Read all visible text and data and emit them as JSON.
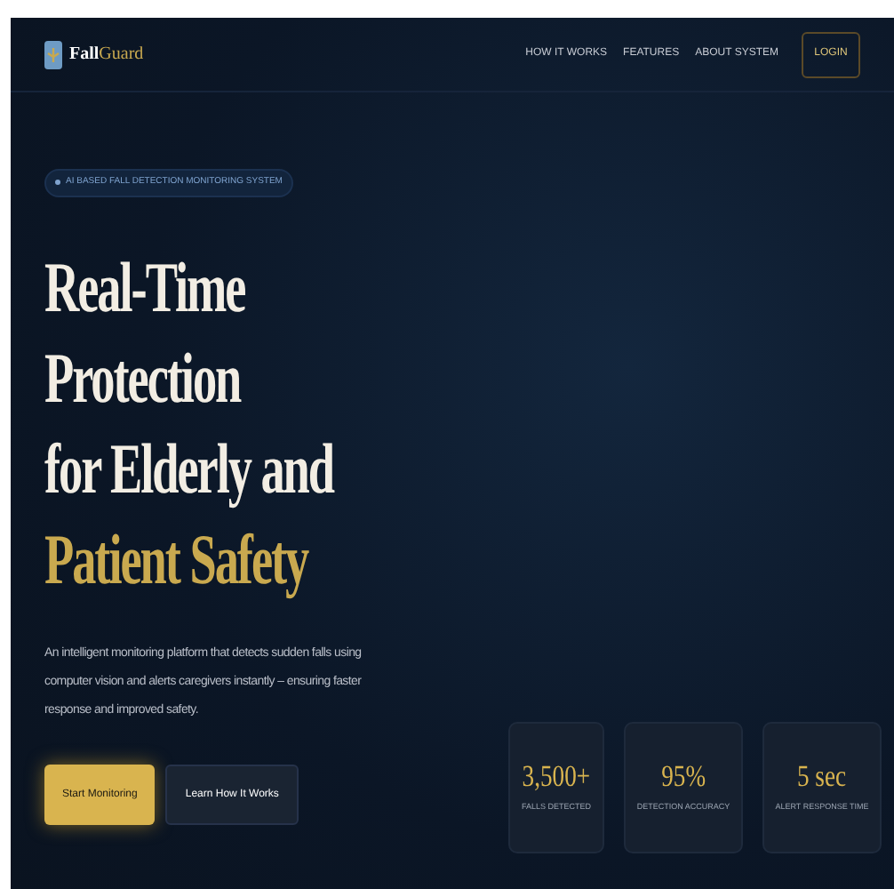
{
  "brand": {
    "name_first": "Fall",
    "name_second": "Guard"
  },
  "nav": {
    "links": [
      "HOW IT WORKS",
      "FEATURES",
      "ABOUT SYSTEM"
    ],
    "login": "LOGIN"
  },
  "badge": "AI BASED FALL DETECTION MONITORING SYSTEM",
  "headline": {
    "lines": [
      "Real-Time",
      "Protection",
      "for Elderly and"
    ],
    "accent": "Patient Safety"
  },
  "description": "An intelligent monitoring platform that detects sudden falls using computer vision and alerts caregivers instantly – ensuring faster response and improved safety.",
  "buttons": [
    {
      "label": "Start Monitoring",
      "kind": "primary"
    },
    {
      "label": "Learn How It Works",
      "kind": "secondary"
    }
  ],
  "stats": [
    {
      "value": "3,500+",
      "label": "FALLS DETECTED"
    },
    {
      "value": "95%",
      "label": "DETECTION ACCURACY"
    },
    {
      "value": "5 sec",
      "label": "ALERT RESPONSE TIME"
    }
  ]
}
